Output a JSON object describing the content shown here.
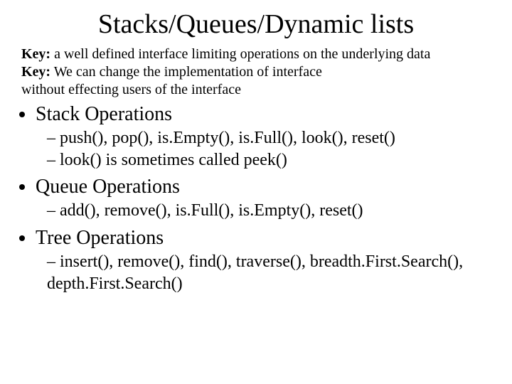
{
  "title": "Stacks/Queues/Dynamic lists",
  "keys": {
    "label": "Key:",
    "line1": " a well defined interface limiting operations on the underlying data",
    "line2": " We can change the implementation of interface",
    "line3": "without effecting users of the interface"
  },
  "sections": [
    {
      "heading": "Stack Operations",
      "items": [
        "push(), pop(), is.Empty(), is.Full(), look(), reset()",
        "look() is sometimes called peek()"
      ]
    },
    {
      "heading": "Queue Operations",
      "items": [
        "add(), remove(), is.Full(), is.Empty(), reset()"
      ]
    },
    {
      "heading": "Tree Operations",
      "items": [
        "insert(), remove(), find(), traverse(), breadth.First.Search(), depth.First.Search()"
      ]
    }
  ]
}
